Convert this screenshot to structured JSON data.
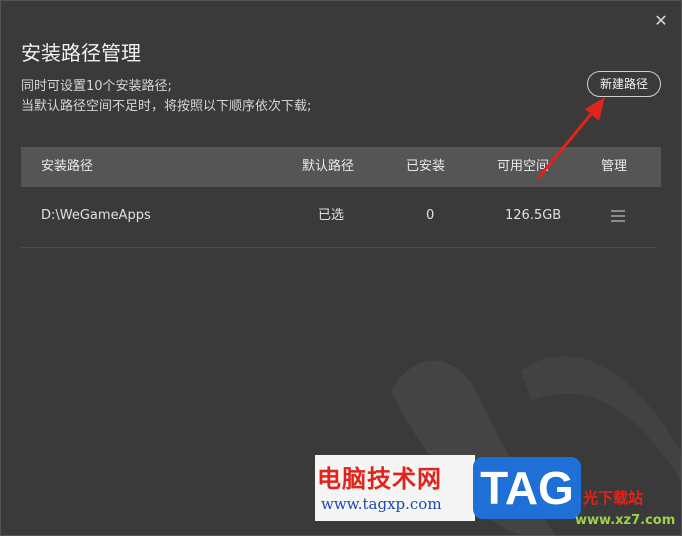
{
  "dialog": {
    "title": "安装路径管理",
    "desc_line1": "同时可设置10个安装路径;",
    "desc_line2": "当默认路径空间不足时，将按照以下顺序依次下载;",
    "new_path_label": "新建路径",
    "close_glyph": "✕"
  },
  "table": {
    "headers": {
      "path": "安装路径",
      "default": "默认路径",
      "installed": "已安装",
      "space": "可用空间",
      "manage": "管理"
    },
    "rows": [
      {
        "path": "D:\\WeGameApps",
        "default": "已选",
        "installed": "0",
        "space": "126.5GB"
      }
    ]
  },
  "watermark": {
    "site_cn": "电脑技术网",
    "site_url": "www.tagxp.com",
    "tag": "TAG",
    "right_cn": "光下载站",
    "right_url": "www.xz7.com"
  },
  "colors": {
    "accent_red": "#e2231a",
    "tag_blue": "#1e6fd6"
  }
}
